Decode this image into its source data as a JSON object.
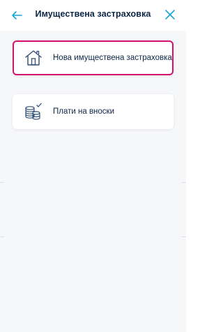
{
  "header": {
    "title": "Имуществена застраховка",
    "back_icon": "arrow-left-icon",
    "close_icon": "close-icon",
    "accent_color": "#1aa3d4"
  },
  "options": [
    {
      "label": "Нова имуществена застраховка",
      "icon": "house-icon",
      "selected": true
    },
    {
      "label": "Плати на вноски",
      "icon": "coins-check-icon",
      "selected": false
    }
  ],
  "colors": {
    "selected_border": "#d4126d",
    "text": "#0b2545",
    "icon": "#2f4f73",
    "background": "#f6f7f9"
  }
}
